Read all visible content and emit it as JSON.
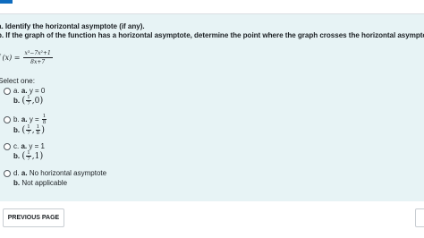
{
  "question": {
    "line_a": "a. Identify the horizontal asymptote (if any).",
    "line_b": "b. If the graph of the function has a horizontal asymptote, determine the point where the graph crosses the horizontal asymptote.",
    "function_label": "f (x) =",
    "numerator": "x³−7x²+1",
    "denominator": "8x+7",
    "select_one": "Select one:"
  },
  "options": [
    {
      "letter": "a.",
      "a_label": "a.",
      "a_text": "y = 0",
      "b_label": "b.",
      "b_point_num1": "1",
      "b_point_den1": "7",
      "b_point_second": "0"
    },
    {
      "letter": "b.",
      "a_label": "a.",
      "a_text": "y =",
      "a_frac_num": "1",
      "a_frac_den": "8",
      "b_label": "b.",
      "b_point_num1": "1",
      "b_point_den1": "7",
      "b_point_num2": "1",
      "b_point_den2": "8"
    },
    {
      "letter": "c.",
      "a_label": "a.",
      "a_text": "y = 1",
      "b_label": "b.",
      "b_point_num1": "1",
      "b_point_den1": "7",
      "b_point_second": "1"
    },
    {
      "letter": "d.",
      "a_label": "a.",
      "a_text": "No horizontal asymptote",
      "b_label": "b.",
      "b_text": "Not applicable"
    }
  ],
  "navigation": {
    "previous_label": "PREVIOUS PAGE"
  },
  "colors": {
    "panel": "#e7f3f5",
    "accent": "#0f6cbf"
  }
}
